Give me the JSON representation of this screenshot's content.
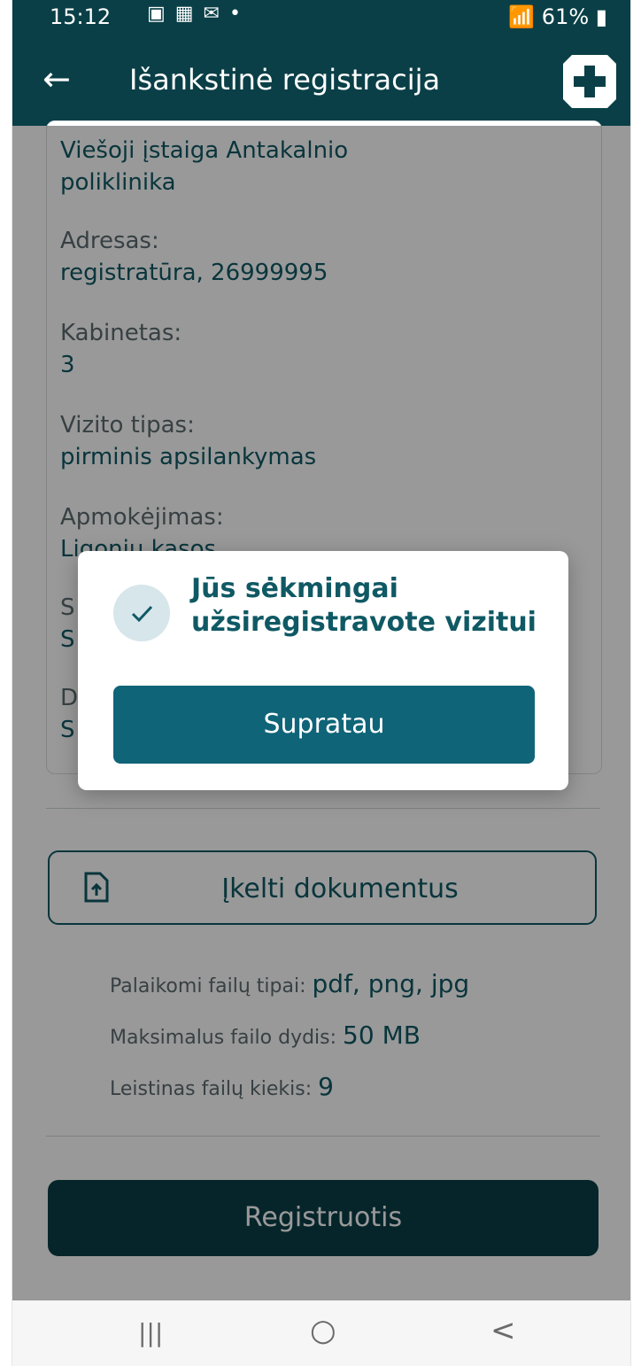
{
  "status_bar": {
    "time": "15:12",
    "battery": "61%"
  },
  "app_bar": {
    "title": "Išankstinė registracija"
  },
  "details": {
    "institution_value": "Viešoji įstaiga Antakalnio poliklinika",
    "address_label": "Adresas:",
    "address_value": "registratūra, 26999995",
    "cabinet_label": "Kabinetas:",
    "cabinet_value": "3",
    "visit_type_label": "Vizito tipas:",
    "visit_type_value": "pirminis apsilankymas",
    "payment_label": "Apmokėjimas:",
    "payment_value": "Ligonių kasos",
    "row6_label": "S",
    "row6_value": "S",
    "row7_label": "D",
    "row7_value": "S"
  },
  "upload": {
    "button_label": "Įkelti dokumentus",
    "types_label": "Palaikomi failų tipai:",
    "types_value": "pdf, png, jpg",
    "max_size_label": "Maksimalus failo dydis:",
    "max_size_value": "50 MB",
    "count_label": "Leistinas failų kiekis:",
    "count_value": "9"
  },
  "register_button": "Registruotis",
  "dialog": {
    "message": "Jūs sėkmingai užsiregistravote vizitui",
    "ok_label": "Supratau"
  },
  "nav_bar": {
    "recent": "|||",
    "home": "○",
    "back": "<"
  }
}
